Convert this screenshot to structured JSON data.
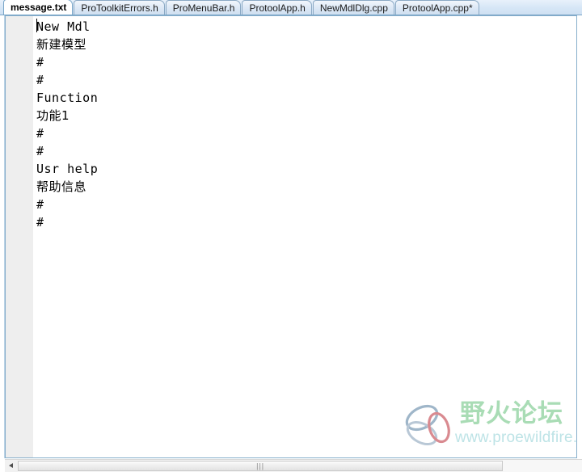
{
  "window": {
    "title": "message.txt",
    "accent_color": "#86aecb",
    "tabbar_bg": "#d6e6f6"
  },
  "tabs": [
    {
      "label": "message.txt",
      "active": true,
      "modified": false
    },
    {
      "label": "ProToolkitErrors.h",
      "active": false,
      "modified": false
    },
    {
      "label": "ProMenuBar.h",
      "active": false,
      "modified": false
    },
    {
      "label": "ProtoolApp.h",
      "active": false,
      "modified": false
    },
    {
      "label": "NewMdlDlg.cpp",
      "active": false,
      "modified": false
    },
    {
      "label": "ProtoolApp.cpp*",
      "active": false,
      "modified": true
    }
  ],
  "editor": {
    "gutter_color": "#eeeeee",
    "background": "#ffffff",
    "text_color": "#000000",
    "caret_line": 1,
    "lines": [
      {
        "text": "New Mdl",
        "cjk": false
      },
      {
        "text": "新建模型",
        "cjk": true
      },
      {
        "text": "#",
        "cjk": false
      },
      {
        "text": "#",
        "cjk": false
      },
      {
        "text": "Function",
        "cjk": false
      },
      {
        "text": "功能1",
        "cjk": true
      },
      {
        "text": "#",
        "cjk": false
      },
      {
        "text": "#",
        "cjk": false
      },
      {
        "text": "Usr help",
        "cjk": false
      },
      {
        "text": "帮助信息",
        "cjk": true
      },
      {
        "text": "#",
        "cjk": false
      },
      {
        "text": "#",
        "cjk": false
      }
    ]
  },
  "watermark": {
    "title": "野火论坛",
    "url": "www.proewildfire.cn",
    "title_color": "#a9dcb5",
    "url_color": "#bde3e6",
    "logo_ring_a_color": "#9fb6c9",
    "logo_ring_b_color": "#d98a90"
  },
  "scrollbar": {
    "left_arrow": "◀",
    "right_arrow": "▶",
    "grip": "|||",
    "thumb_width_percent": 86
  }
}
